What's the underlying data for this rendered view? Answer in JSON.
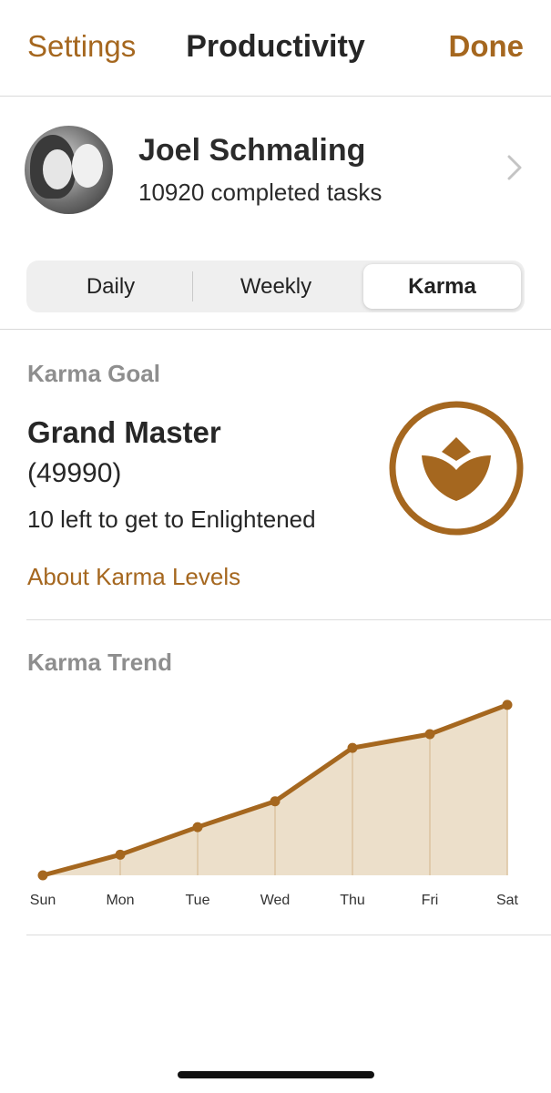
{
  "nav": {
    "back_label": "Settings",
    "title": "Productivity",
    "done_label": "Done"
  },
  "profile": {
    "name": "Joel Schmaling",
    "subtitle": "10920 completed tasks"
  },
  "segments": {
    "daily": "Daily",
    "weekly": "Weekly",
    "karma": "Karma",
    "selected": "Karma"
  },
  "karma_goal": {
    "section_label": "Karma Goal",
    "level": "Grand Master",
    "points": "(49990)",
    "remaining": "10 left to get to Enlightened",
    "about_link": "About Karma Levels"
  },
  "karma_trend": {
    "section_label": "Karma Trend"
  },
  "colors": {
    "accent": "#a5671f",
    "chart_fill": "#ecdfca",
    "chart_line": "#a5671f",
    "secondary_text": "#8e8e8e"
  },
  "chart_data": {
    "type": "area",
    "categories": [
      "Sun",
      "Mon",
      "Tue",
      "Wed",
      "Thu",
      "Fri",
      "Sat"
    ],
    "values": [
      0,
      12,
      28,
      43,
      74,
      82,
      99
    ],
    "ylim": [
      0,
      100
    ]
  }
}
